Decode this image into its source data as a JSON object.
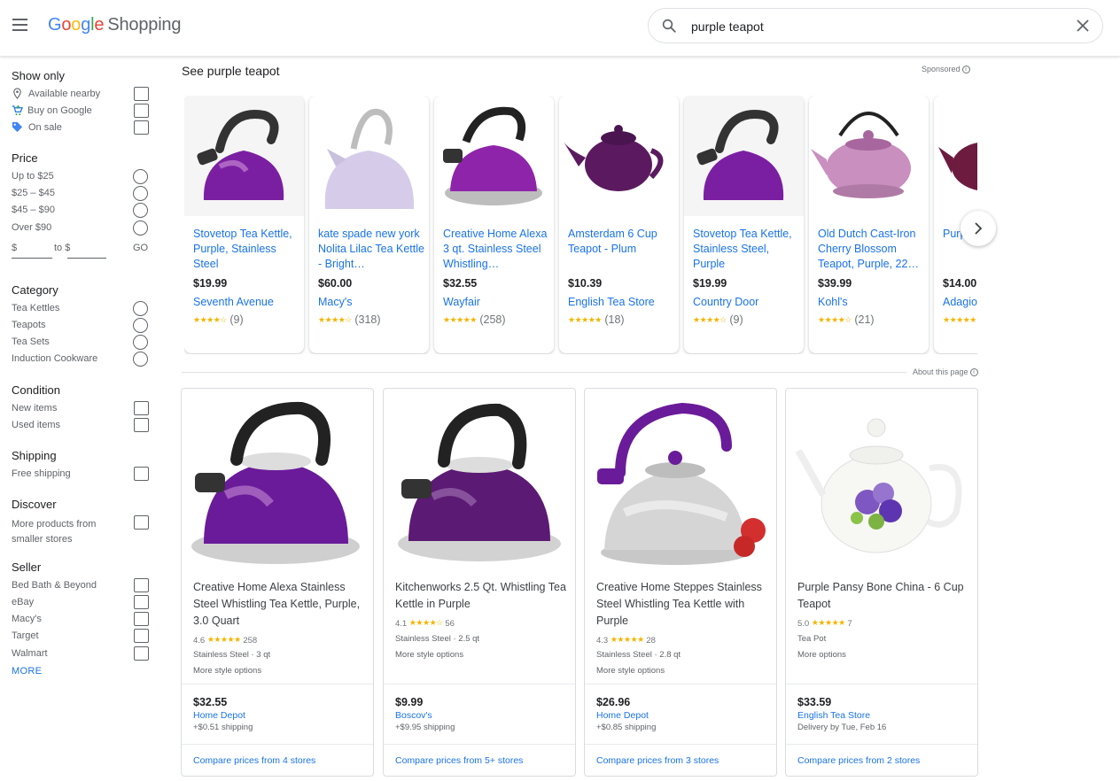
{
  "header": {
    "logo_google": [
      "G",
      "o",
      "o",
      "g",
      "l",
      "e"
    ],
    "logo_shopping": "Shopping",
    "search_value": "purple teapot"
  },
  "sidebar": {
    "show_only": {
      "title": "Show only",
      "items": [
        "Available nearby",
        "Buy on Google",
        "On sale"
      ]
    },
    "price": {
      "title": "Price",
      "items": [
        "Up to $25",
        "$25 – $45",
        "$45 – $90",
        "Over $90"
      ],
      "min_prefix": "$",
      "to_label": "to $",
      "go_label": "GO"
    },
    "category": {
      "title": "Category",
      "items": [
        "Tea Kettles",
        "Teapots",
        "Tea Sets",
        "Induction Cookware"
      ]
    },
    "condition": {
      "title": "Condition",
      "items": [
        "New items",
        "Used items"
      ]
    },
    "shipping": {
      "title": "Shipping",
      "items": [
        "Free shipping"
      ]
    },
    "discover": {
      "title": "Discover",
      "items": [
        "More products from smaller stores"
      ]
    },
    "seller": {
      "title": "Seller",
      "items": [
        "Bed Bath & Beyond",
        "eBay",
        "Macy's",
        "Target",
        "Walmart"
      ],
      "more": "MORE"
    }
  },
  "sponsored": {
    "title": "See purple teapot",
    "label": "Sponsored",
    "cards": [
      {
        "title": "Stovetop Tea Kettle, Purple, Stainless Steel",
        "price": "$19.99",
        "store": "Seventh Avenue",
        "stars": "★★★★☆",
        "reviews": "(9)"
      },
      {
        "title": "kate spade new york Nolita Lilac Tea Kettle - Bright…",
        "price": "$60.00",
        "store": "Macy's",
        "stars": "★★★★☆",
        "reviews": "(318)"
      },
      {
        "title": "Creative Home Alexa 3 qt. Stainless Steel Whistling…",
        "price": "$32.55",
        "store": "Wayfair",
        "stars": "★★★★★",
        "reviews": "(258)"
      },
      {
        "title": "Amsterdam 6 Cup Teapot - Plum",
        "price": "$10.39",
        "store": "English Tea Store",
        "stars": "★★★★★",
        "reviews": "(18)"
      },
      {
        "title": "Stovetop Tea Kettle, Stainless Steel, Purple",
        "price": "$19.99",
        "store": "Country Door",
        "stars": "★★★★☆",
        "reviews": "(9)"
      },
      {
        "title": "Old Dutch Cast-Iron Cherry Blossom Teapot, Purple, 22…",
        "price": "$39.99",
        "store": "Kohl's",
        "stars": "★★★★☆",
        "reviews": "(21)"
      },
      {
        "title": "Purple…",
        "price": "$14.00",
        "store": "Adagio",
        "stars": "★★★★★",
        "reviews": ""
      }
    ]
  },
  "about_page": "About this page",
  "products": [
    {
      "title": "Creative Home Alexa Stainless Steel Whistling Tea Kettle, Purple, 3.0 Quart",
      "rating": "4.6",
      "stars": "★★★★★",
      "reviews": "258",
      "attrs": "Stainless Steel · 3 qt",
      "options": "More style options",
      "price": "$32.55",
      "store": "Home Depot",
      "shipping": "+$0.51 shipping",
      "compare": "Compare prices from 4 stores"
    },
    {
      "title": "Kitchenworks 2.5 Qt. Whistling Tea Kettle in Purple",
      "rating": "4.1",
      "stars": "★★★★☆",
      "reviews": "56",
      "attrs": "Stainless Steel · 2.5 qt",
      "options": "More style options",
      "price": "$9.99",
      "store": "Boscov's",
      "shipping": "+$9.95 shipping",
      "compare": "Compare prices from 5+ stores"
    },
    {
      "title": "Creative Home Steppes Stainless Steel Whistling Tea Kettle with Purple",
      "rating": "4.3",
      "stars": "★★★★★",
      "reviews": "28",
      "attrs": "Stainless Steel · 2.8 qt",
      "options": "More style options",
      "price": "$26.96",
      "store": "Home Depot",
      "shipping": "+$0.85 shipping",
      "compare": "Compare prices from 3 stores"
    },
    {
      "title": "Purple Pansy Bone China - 6 Cup Teapot",
      "rating": "5.0",
      "stars": "★★★★★",
      "reviews": "7",
      "attrs": "Tea Pot",
      "options": "More options",
      "price": "$33.59",
      "store": "English Tea Store",
      "shipping": "Delivery by Tue, Feb 16",
      "compare": "Compare prices from 2 stores"
    }
  ],
  "icons": {
    "menu": "menu-icon",
    "search": "search-icon",
    "clear": "close-icon",
    "next": "chevron-right-icon",
    "nearby": "location-pin-icon",
    "buy": "cart-icon",
    "sale": "tag-icon",
    "info": "info-icon"
  },
  "colors": {
    "link": "#1a73e8",
    "star": "#f4b400",
    "purple": "#7b1fa2"
  }
}
